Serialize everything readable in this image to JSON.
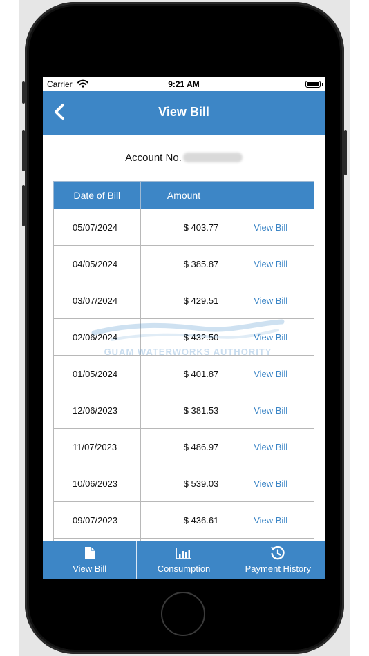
{
  "status_bar": {
    "carrier": "Carrier",
    "time": "9:21 AM"
  },
  "nav": {
    "title": "View Bill",
    "back_icon": "chevron-left-icon"
  },
  "account": {
    "label": "Account No."
  },
  "table": {
    "headers": [
      "Date of Bill",
      "Amount",
      ""
    ],
    "rows": [
      {
        "date": "05/07/2024",
        "amount": "$ 403.77",
        "link": "View Bill"
      },
      {
        "date": "04/05/2024",
        "amount": "$ 385.87",
        "link": "View Bill"
      },
      {
        "date": "03/07/2024",
        "amount": "$ 429.51",
        "link": "View Bill"
      },
      {
        "date": "02/06/2024",
        "amount": "$ 432.50",
        "link": "View Bill"
      },
      {
        "date": "01/05/2024",
        "amount": "$ 401.87",
        "link": "View Bill"
      },
      {
        "date": "12/06/2023",
        "amount": "$ 381.53",
        "link": "View Bill"
      },
      {
        "date": "11/07/2023",
        "amount": "$ 486.97",
        "link": "View Bill"
      },
      {
        "date": "10/06/2023",
        "amount": "$ 539.03",
        "link": "View Bill"
      },
      {
        "date": "09/07/2023",
        "amount": "$ 436.61",
        "link": "View Bill"
      },
      {
        "date": "",
        "amount": "",
        "link": ""
      }
    ]
  },
  "watermark": {
    "text": "GUAM WATERWORKS AUTHORITY"
  },
  "tabs": [
    {
      "label": "View Bill",
      "icon": "document-icon"
    },
    {
      "label": "Consumption",
      "icon": "bar-chart-icon"
    },
    {
      "label": "Payment History",
      "icon": "history-icon"
    }
  ],
  "colors": {
    "accent": "#3d86c6",
    "link": "#3d86c6"
  }
}
